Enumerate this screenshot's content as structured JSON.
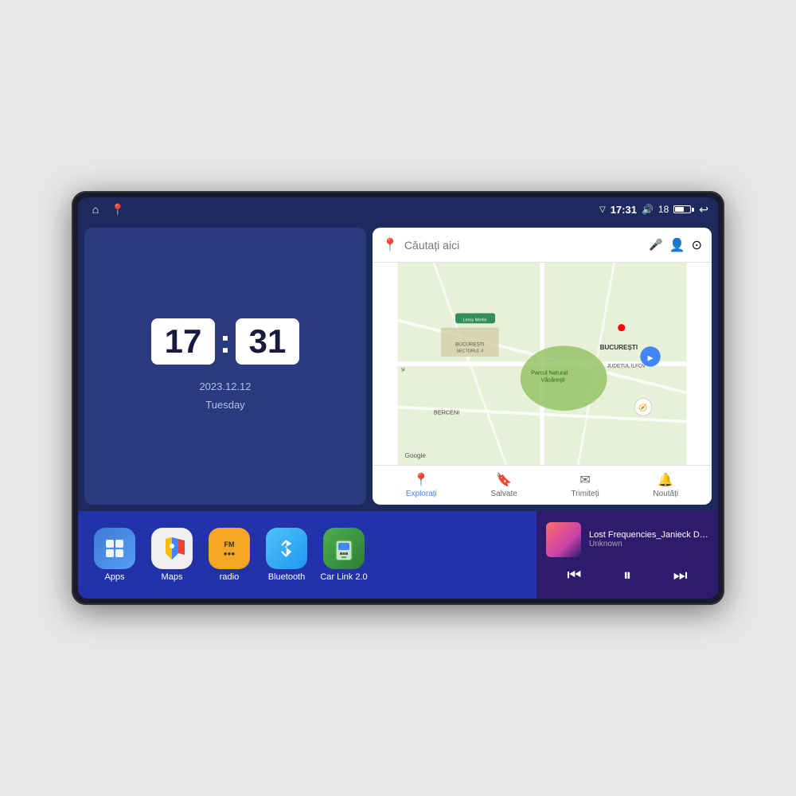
{
  "device": {
    "status_bar": {
      "signal_icon": "▽",
      "time": "17:31",
      "volume_icon": "🔊",
      "battery_level": "18",
      "home_icon": "⌂",
      "maps_icon": "📍",
      "back_icon": "↩"
    },
    "clock": {
      "hours": "17",
      "minutes": "31",
      "date": "2023.12.12",
      "day": "Tuesday"
    },
    "map": {
      "search_placeholder": "Căutați aici",
      "nav_items": [
        {
          "label": "Explorați",
          "icon": "📍",
          "active": true
        },
        {
          "label": "Salvate",
          "icon": "🔖",
          "active": false
        },
        {
          "label": "Trimiteți",
          "icon": "✉",
          "active": false
        },
        {
          "label": "Noutăți",
          "icon": "🔔",
          "active": false
        }
      ]
    },
    "apps": [
      {
        "id": "apps",
        "label": "Apps",
        "icon": "⊞",
        "color_class": "icon-apps"
      },
      {
        "id": "maps",
        "label": "Maps",
        "icon": "🗺",
        "color_class": "icon-maps"
      },
      {
        "id": "radio",
        "label": "radio",
        "icon": "📻",
        "color_class": "icon-radio"
      },
      {
        "id": "bluetooth",
        "label": "Bluetooth",
        "icon": "🔷",
        "color_class": "icon-bluetooth"
      },
      {
        "id": "carlink",
        "label": "Car Link 2.0",
        "icon": "📱",
        "color_class": "icon-carlink"
      }
    ],
    "music": {
      "title": "Lost Frequencies_Janieck Devy-...",
      "artist": "Unknown",
      "prev_icon": "⏮",
      "play_icon": "⏸",
      "next_icon": "⏭"
    }
  }
}
